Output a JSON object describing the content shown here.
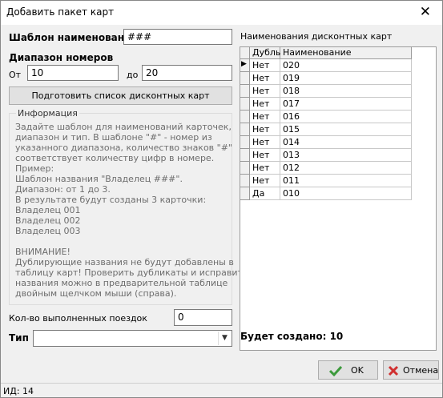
{
  "window": {
    "title": "Добавить пакет карт"
  },
  "template": {
    "label": "Шаблон наименования",
    "value": "###"
  },
  "range": {
    "label": "Диапазон номеров",
    "from_label": "От",
    "from_value": "10",
    "to_label": "до",
    "to_value": "20"
  },
  "prepare_button": "Подготовить список дисконтных карт",
  "info": {
    "legend": "Информация",
    "lines": [
      "Задайте шаблон для наименований карточек,",
      "диапазон и тип. В шаблоне \"#\" - номер из",
      "указанного диапазона, количество знаков \"#\"",
      "соответствует количеству цифр в номере.",
      "Пример:",
      "Шаблон названия \"Владелец ###\".",
      "Диапазон: от 1 до 3.",
      "В результате будут созданы 3 карточки:",
      "Владелец 001",
      "Владелец 002",
      "Владелец 003",
      "",
      "ВНИМАНИЕ!",
      "Дублирующие названия не будут добавлены в",
      "таблицу карт! Проверить дубликаты и исправить",
      "названия можно в предварительной таблице",
      "двойным щелчком мыши (справа)."
    ]
  },
  "trips": {
    "label": "Кол-во выполненных поездок",
    "value": "0"
  },
  "type": {
    "label": "Тип",
    "value": ""
  },
  "list": {
    "label": "Наименования дисконтных карт",
    "columns": [
      "Дубль",
      "Наименование"
    ],
    "rows": [
      {
        "dup": "Нет",
        "name": "020"
      },
      {
        "dup": "Нет",
        "name": "019"
      },
      {
        "dup": "Нет",
        "name": "018"
      },
      {
        "dup": "Нет",
        "name": "017"
      },
      {
        "dup": "Нет",
        "name": "016"
      },
      {
        "dup": "Нет",
        "name": "015"
      },
      {
        "dup": "Нет",
        "name": "014"
      },
      {
        "dup": "Нет",
        "name": "013"
      },
      {
        "dup": "Нет",
        "name": "012"
      },
      {
        "dup": "Нет",
        "name": "011"
      },
      {
        "dup": "Да",
        "name": "010"
      }
    ],
    "current_row_marker": "▶"
  },
  "summary": "Будет создано: 10",
  "ok_button": "OK",
  "cancel_button": "Отмена",
  "status": "ИД: 14",
  "colors": {
    "ok_check": "#3c9a3c",
    "cancel_x": "#d03030"
  }
}
